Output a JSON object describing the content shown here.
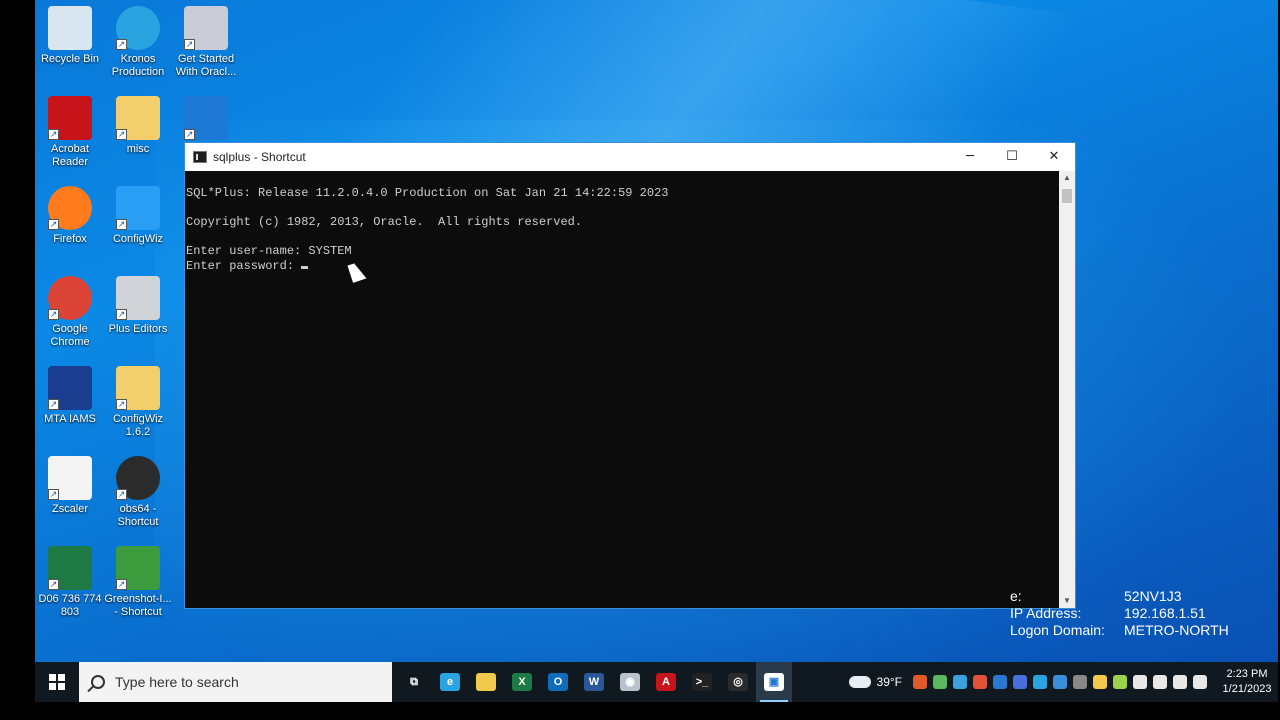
{
  "desktop_icons": [
    {
      "label": "Recycle Bin",
      "icon": "recycle-bin-icon",
      "color": "#d9e6f2"
    },
    {
      "label": "Kronos Production",
      "icon": "edge-icon",
      "color": "#2aa4e0"
    },
    {
      "label": "Get Started With Oracl...",
      "icon": "oracle-xe-icon",
      "color": "#c9ccd6"
    },
    {
      "label": "Acrobat Reader",
      "icon": "acrobat-icon",
      "color": "#c7141a"
    },
    {
      "label": "misc",
      "icon": "folder-icon",
      "color": "#f2cf6b"
    },
    {
      "label": "",
      "icon": "window-app-icon",
      "color": "#1e78d6"
    },
    {
      "label": "Firefox",
      "icon": "firefox-icon",
      "color": "#ff7b1c"
    },
    {
      "label": "ConfigWiz",
      "icon": "qei-icon",
      "color": "#2a9df4"
    },
    {
      "label": "Google Chrome",
      "icon": "chrome-icon",
      "color": "#db4437"
    },
    {
      "label": "Plus Editors",
      "icon": "rocket-icon",
      "color": "#cfd3d8"
    },
    {
      "label": "MTA IAMS",
      "icon": "mta-iams-icon",
      "color": "#1b3d8f"
    },
    {
      "label": "ConfigWiz 1.6.2",
      "icon": "folder-zip-icon",
      "color": "#f2cf6b"
    },
    {
      "label": "Zscaler",
      "icon": "document-icon",
      "color": "#f4f4f4"
    },
    {
      "label": "obs64 - Shortcut",
      "icon": "obs-icon",
      "color": "#2b2b2b"
    },
    {
      "label": "D06 736 774 803",
      "icon": "excel-icon",
      "color": "#1d7a44"
    },
    {
      "label": "Greenshot-I... - Shortcut",
      "icon": "greenshot-icon",
      "color": "#3c9b3c"
    }
  ],
  "window": {
    "title": "sqlplus - Shortcut",
    "minimize": "─",
    "maximize": "☐",
    "close": "✕"
  },
  "console": {
    "line1": "SQL*Plus: Release 11.2.0.4.0 Production on Sat Jan 21 14:22:59 2023",
    "line2": "Copyright (c) 1982, 2013, Oracle.  All rights reserved.",
    "line3": "Enter user-name: SYSTEM",
    "line4": "Enter password: "
  },
  "bginfo": {
    "rows": [
      {
        "key": "e:",
        "value": "52NV1J3"
      },
      {
        "key": "IP Address:",
        "value": "192.168.1.51"
      },
      {
        "key": "Logon Domain:",
        "value": "METRO-NORTH"
      }
    ]
  },
  "taskbar": {
    "search_placeholder": "Type here to search",
    "apps": [
      {
        "icon": "task-view-icon",
        "color": "#101820",
        "glyph": "⧉"
      },
      {
        "icon": "edge-icon",
        "color": "#2aa4e0",
        "glyph": "e"
      },
      {
        "icon": "file-explorer-icon",
        "color": "#f2c94c",
        "glyph": ""
      },
      {
        "icon": "excel-icon",
        "color": "#1d7a44",
        "glyph": "X"
      },
      {
        "icon": "outlook-icon",
        "color": "#0f6cbd",
        "glyph": "O"
      },
      {
        "icon": "word-icon",
        "color": "#2b579a",
        "glyph": "W"
      },
      {
        "icon": "vpn-icon",
        "color": "#b9c2cc",
        "glyph": "◉"
      },
      {
        "icon": "acrobat-icon",
        "color": "#c7141a",
        "glyph": "A"
      },
      {
        "icon": "terminal-icon",
        "color": "#222222",
        "glyph": ">_"
      },
      {
        "icon": "obs-icon",
        "color": "#2b2b2b",
        "glyph": "◎"
      },
      {
        "icon": "console-window-icon",
        "color": "#ffffff",
        "glyph": "▣"
      }
    ],
    "weather": "39°F",
    "tray_colors": [
      "#e05a2a",
      "#5cb85c",
      "#3aa0e0",
      "#e0533a",
      "#2b78d0",
      "#4a6fdc",
      "#2aa4e0",
      "#3a8fd8",
      "#888888",
      "#f2c94c",
      "#9bd24a",
      "#e8e8e8",
      "#e8e8e8",
      "#e8e8e8",
      "#e8e8e8"
    ],
    "time": "2:23 PM",
    "date": "1/21/2023"
  }
}
